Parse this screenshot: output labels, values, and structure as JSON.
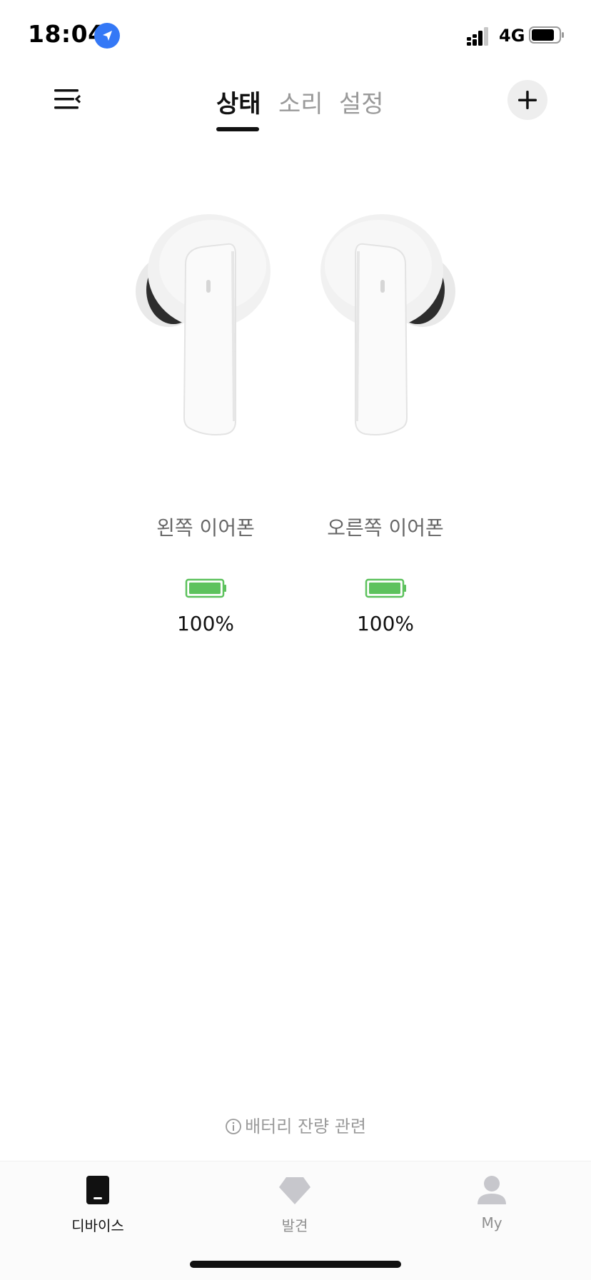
{
  "status_bar": {
    "time": "18:04",
    "network": "4G",
    "icons": [
      "location-icon",
      "signal-icon",
      "battery-icon"
    ]
  },
  "header": {
    "tabs": [
      {
        "label": "상태",
        "active": true
      },
      {
        "label": "소리",
        "active": false
      },
      {
        "label": "설정",
        "active": false
      }
    ],
    "icons": [
      "menu-icon",
      "plus-icon"
    ]
  },
  "earbuds": {
    "left": {
      "label": "왼쪽 이어폰",
      "battery": "100%",
      "level": 1.0
    },
    "right": {
      "label": "오른쪽 이어폰",
      "battery": "100%",
      "level": 1.0
    },
    "battery_color": "#5dc25d"
  },
  "info": {
    "text": "배터리 잔량 관련",
    "icon": "info-icon"
  },
  "bottom_nav": {
    "items": [
      {
        "label": "디바이스",
        "icon": "device-icon",
        "active": true
      },
      {
        "label": "발견",
        "icon": "diamond-icon",
        "active": false
      },
      {
        "label": "My",
        "icon": "person-icon",
        "active": false
      }
    ]
  },
  "colors": {
    "accent": "#111111",
    "inactive": "#9a9a9a",
    "location": "#3478f6"
  }
}
